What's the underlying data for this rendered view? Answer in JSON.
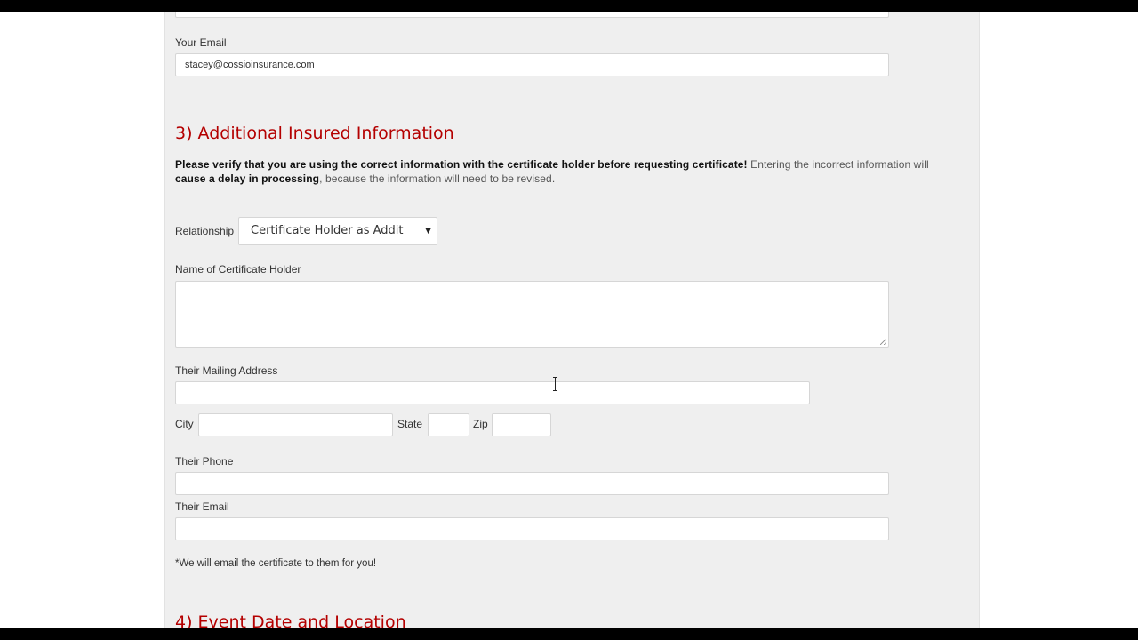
{
  "form": {
    "your_email": {
      "label": "Your Email",
      "value": "stacey@cossioinsurance.com"
    },
    "section3": {
      "title": "3) Additional Insured Information",
      "warning_bold_1": "Please verify that you are using the correct information with the certificate holder before requesting certificate!",
      "warning_text_1": " Entering the incorrect information will ",
      "warning_bold_2": "cause a delay in processing",
      "warning_text_2": ", because the information will need to be revised."
    },
    "relationship": {
      "label": "Relationship",
      "selected": "Certificate Holder as Addit"
    },
    "holder_name": {
      "label": "Name of Certificate Holder",
      "value": ""
    },
    "mailing_address": {
      "label": "Their Mailing Address",
      "value": ""
    },
    "city": {
      "label": "City",
      "value": ""
    },
    "state": {
      "label": "State",
      "value": ""
    },
    "zip": {
      "label": "Zip",
      "value": ""
    },
    "phone": {
      "label": "Their Phone",
      "value": ""
    },
    "email": {
      "label": "Their Email",
      "value": ""
    },
    "email_note": "*We will email the certificate to them for you!",
    "section4": {
      "title": "4) Event Date and Location"
    }
  },
  "icons": {
    "select_arrow": "▼",
    "text_cursor": "i-beam-cursor-icon"
  },
  "colors": {
    "section_title": "#b40000",
    "panel_background": "#efefef"
  }
}
